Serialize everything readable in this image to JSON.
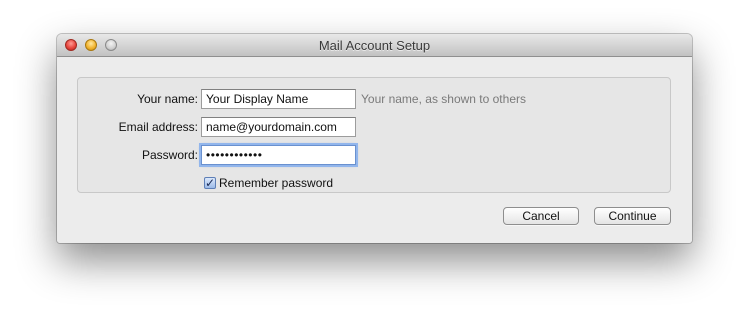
{
  "window": {
    "title": "Mail Account Setup"
  },
  "form": {
    "name": {
      "label": "Your name:",
      "value": "Your Display Name",
      "hint": "Your name, as shown to others"
    },
    "email": {
      "label": "Email address:",
      "value": "name@yourdomain.com"
    },
    "password": {
      "label": "Password:",
      "value": "••••••••••••"
    },
    "remember": {
      "label": "Remember password",
      "checked": true,
      "check_glyph": "✓"
    }
  },
  "buttons": {
    "cancel": "Cancel",
    "continue": "Continue"
  },
  "colors": {
    "close": "#e8473f",
    "minimize": "#f2b531",
    "zoom": "#cfcfcf",
    "focus_ring": "#92b6ec"
  }
}
